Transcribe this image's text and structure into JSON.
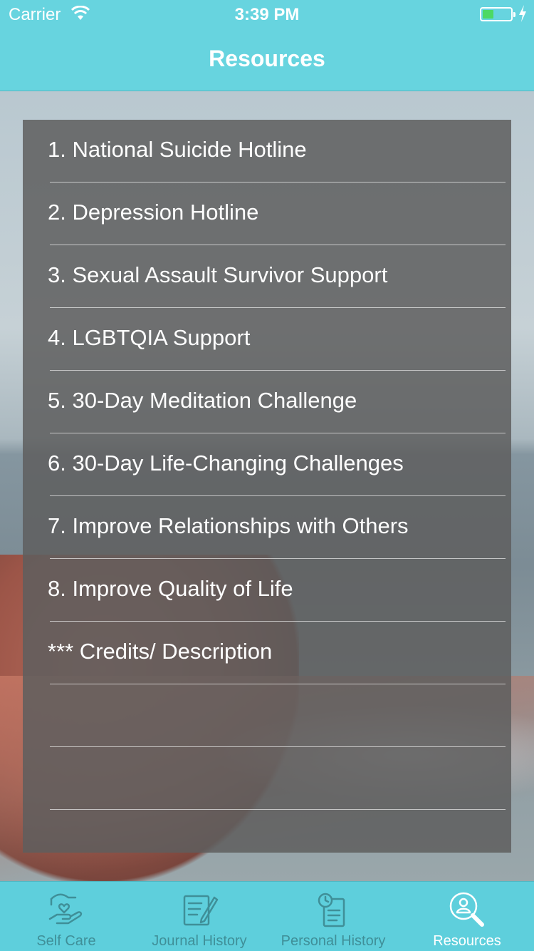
{
  "status_bar": {
    "carrier": "Carrier",
    "time": "3:39 PM",
    "battery_level": 0.4,
    "battery_color": "#4cd964"
  },
  "nav": {
    "title": "Resources",
    "bar_color": "#67d4df"
  },
  "resources": {
    "items": [
      {
        "label": "1. National Suicide Hotline"
      },
      {
        "label": "2. Depression Hotline"
      },
      {
        "label": "3. Sexual Assault Survivor Support"
      },
      {
        "label": "4. LGBTQIA Support"
      },
      {
        "label": "5. 30-Day Meditation Challenge"
      },
      {
        "label": "6. 30-Day Life-Changing Challenges"
      },
      {
        "label": "7. Improve Relationships with Others"
      },
      {
        "label": "8. Improve Quality of Life"
      },
      {
        "label": "*** Credits/ Description"
      },
      {
        "label": ""
      },
      {
        "label": ""
      }
    ]
  },
  "tab_bar": {
    "tabs": [
      {
        "label": "Self Care",
        "icon": "self-care-icon",
        "active": false
      },
      {
        "label": "Journal History",
        "icon": "journal-icon",
        "active": false
      },
      {
        "label": "Personal History",
        "icon": "history-icon",
        "active": false
      },
      {
        "label": "Resources",
        "icon": "resources-search-icon",
        "active": true
      }
    ],
    "active_color": "#ffffff",
    "inactive_color": "#3f8f98"
  }
}
